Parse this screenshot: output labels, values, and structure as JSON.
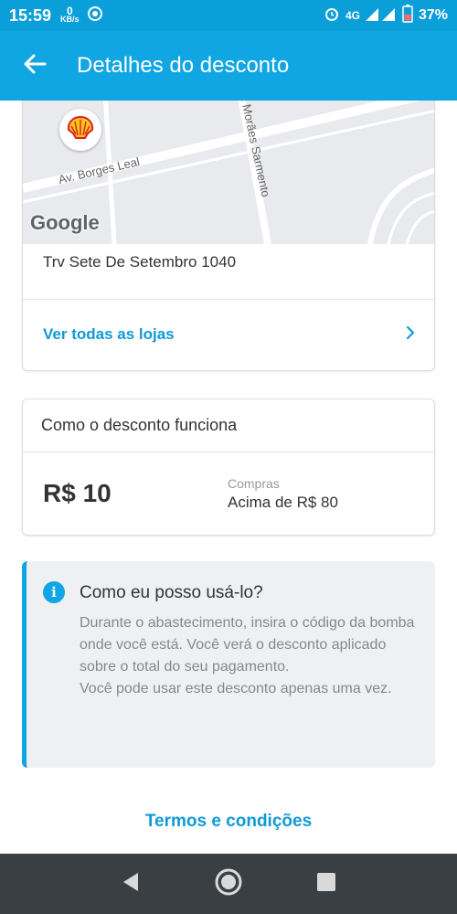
{
  "status_bar": {
    "time": "15:59",
    "net_speed_value": "0",
    "net_speed_unit": "KB/s",
    "network": "4G",
    "battery": "37%"
  },
  "app_bar": {
    "title": "Detalhes do desconto",
    "back_icon": "arrow-left-icon"
  },
  "store": {
    "map_labels": {
      "road_1": "Av. Borges Leal",
      "road_2": "v. Morães Sarmento",
      "provider": "Google"
    },
    "brand_icon": "shell-logo-icon",
    "address": "Trv Sete De Setembro 1040",
    "see_all_label": "Ver todas as lojas"
  },
  "how_it_works": {
    "title": "Como o desconto funciona",
    "discount_value": "R$ 10",
    "requirement_label": "Compras",
    "requirement_value": "Acima de R$ 80"
  },
  "info": {
    "title": "Como eu posso usá-lo?",
    "line_1": "Durante o abastecimento, insira o código da bomba onde você está. Você verá o desconto aplicado sobre o total do seu pagamento.",
    "line_2": "Você pode usar este desconto apenas uma vez."
  },
  "terms_label": "Termos e condições",
  "colors": {
    "primary": "#0fa6e3",
    "status_bar": "#0a9fd9",
    "link": "#0f9ad5",
    "nav_bar": "#3a3f44"
  }
}
